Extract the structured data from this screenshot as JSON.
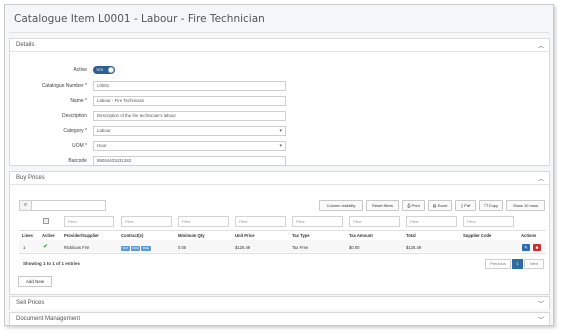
{
  "page": {
    "title": "Catalogue Item L0001 - Labour - Fire Technician"
  },
  "details": {
    "title": "Details",
    "fields": {
      "active": {
        "label": "Active",
        "value": "YES"
      },
      "catalogue_number": {
        "label": "Catalogue Number *",
        "value": "L0001"
      },
      "name": {
        "label": "Name *",
        "value": "Labour - Fire Technician"
      },
      "description": {
        "label": "Description",
        "value": "Description of the fire technician's labour"
      },
      "category": {
        "label": "Category *",
        "value": "Labour"
      },
      "uom": {
        "label": "UOM *",
        "value": "Hour"
      },
      "barcode": {
        "label": "Barcode",
        "value": "95054403431282"
      }
    }
  },
  "buy_prices": {
    "title": "Buy Prices",
    "toolbar": {
      "column_visibility": "Column visibility",
      "reset_filters": "Reset filters",
      "print": "Print",
      "excel": "Excel",
      "pdf": "Pdf",
      "copy": "Copy",
      "show_rows": "Show 10 rows"
    },
    "filter_placeholder": "Filter",
    "columns": {
      "lines": "Lines",
      "active": "Active",
      "provider": "Provider/Supplier",
      "contracts": "Contract(s)",
      "min_qty": "Minimum Qty",
      "unit_price": "Unit Price",
      "tax_type": "Tax Type",
      "tax_amount": "Tax Amount",
      "total": "Total",
      "supplier_code": "Supplier Code",
      "actions": "Actions"
    },
    "rows": [
      {
        "line": "1",
        "active": "✔",
        "provider": "Rickitous Fire",
        "contracts": [
          "SST",
          "FDM",
          "RSE"
        ],
        "min_qty": "0.00",
        "unit_price": "$125.49",
        "tax_type": "Tax Free",
        "tax_amount": "$0.00",
        "total": "$125.49",
        "supplier_code": ""
      }
    ],
    "showing": "Showing 1 to 1 of 1 entries",
    "pager": {
      "previous": "Previous",
      "current": "1",
      "next": "Next"
    },
    "add_new": "Add New"
  },
  "sell_prices": {
    "title": "Sell Prices"
  },
  "document_management": {
    "title": "Document Management"
  },
  "colors": {
    "accent": "#2e5f93",
    "active_check": "#2e8b2e",
    "edit": "#2a6ab5",
    "delete": "#c9302c",
    "tag": "#5b9bd5"
  }
}
